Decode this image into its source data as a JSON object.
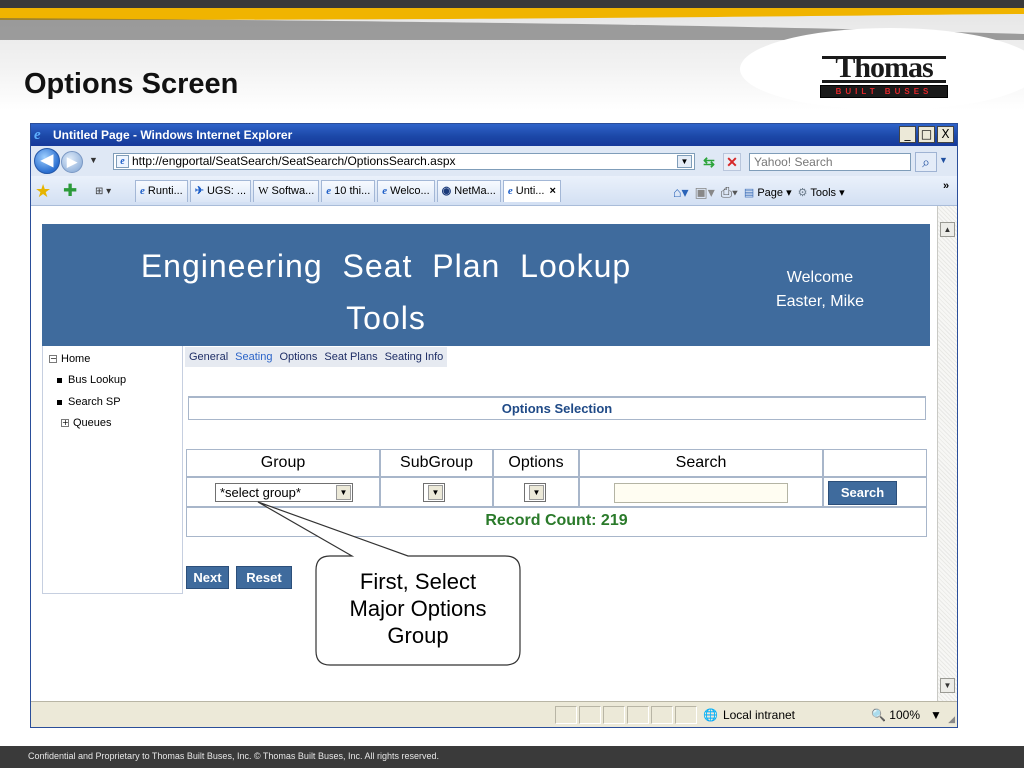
{
  "slide": {
    "title": "Options Screen",
    "logo_word": "Thomas",
    "logo_tagline": "BUILT BUSES",
    "footer": "Confidential and Proprietary to Thomas Built Buses, Inc.  © Thomas Built Buses, Inc.  All rights reserved."
  },
  "browser": {
    "title": "Untitled Page - Windows Internet Explorer",
    "url": "http://engportal/SeatSearch/SeatSearch/OptionsSearch.aspx",
    "search_placeholder": "Yahoo! Search",
    "window_buttons": [
      "_",
      "□",
      "X"
    ],
    "tabs": [
      {
        "label": "Runti...",
        "icon": "ie-icon"
      },
      {
        "label": "UGS: ...",
        "icon": "ugs-icon"
      },
      {
        "label": "Softwa...",
        "icon": "wiki-icon"
      },
      {
        "label": "10 thi...",
        "icon": "ie-icon"
      },
      {
        "label": "Welco...",
        "icon": "ie-icon"
      },
      {
        "label": "NetMa...",
        "icon": "netmail-icon"
      },
      {
        "label": "Unti...",
        "icon": "ie-icon",
        "active": true
      }
    ],
    "tools": {
      "page_label": "Page",
      "tools_label": "Tools"
    },
    "status": {
      "zone": "Local intranet",
      "zoom": "100%"
    }
  },
  "app": {
    "banner_title_line1": "Engineering Seat Plan Lookup",
    "banner_title_line2": "Tools",
    "welcome_label": "Welcome",
    "user_name": "Easter, Mike",
    "nav": [
      {
        "label": "Home",
        "type": "collapse"
      },
      {
        "label": "Bus Lookup",
        "type": "bullet"
      },
      {
        "label": "Search SP",
        "type": "bullet"
      },
      {
        "label": "Queues",
        "type": "expand"
      }
    ],
    "menu": [
      {
        "label": "General",
        "selected": false
      },
      {
        "label": "Seating",
        "selected": true
      },
      {
        "label": "Options",
        "selected": false
      },
      {
        "label": "Seat Plans",
        "selected": false
      },
      {
        "label": "Seating Info",
        "selected": false
      }
    ],
    "options_selection_title": "Options Selection",
    "columns": [
      "Group",
      "SubGroup",
      "Options",
      "Search"
    ],
    "group_select_value": "*select group*",
    "subgroup_select_value": "",
    "options_select_value": "",
    "search_value": "",
    "search_button": "Search",
    "record_count": "Record Count: 219",
    "next_button": "Next",
    "reset_button": "Reset"
  },
  "callout": {
    "text_line1": "First, Select",
    "text_line2": "Major Options",
    "text_line3": "Group"
  },
  "colors": {
    "banner": "#3f6b9d",
    "record_count": "#2a7a2a",
    "titlebar": "#1c48a8"
  }
}
